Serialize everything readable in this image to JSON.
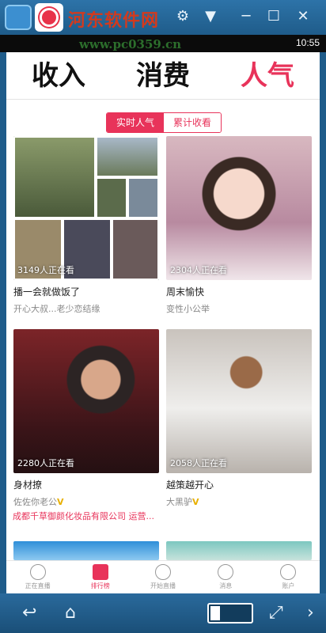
{
  "emulator": {
    "watermark_top": "河东软件网",
    "watermark_url": "www.pc0359.cn",
    "status_time": "10:55",
    "controls": [
      "minimize-icon",
      "restore-icon",
      "close-icon"
    ],
    "bottom_buttons": [
      "back-icon",
      "home-icon",
      "keyboard-icon",
      "fullscreen-icon",
      "next-icon"
    ]
  },
  "header": {
    "tabs": [
      {
        "label": "收入"
      },
      {
        "label": "消费"
      },
      {
        "label": "人气"
      }
    ]
  },
  "segment": {
    "items": [
      {
        "label": "实时人气"
      },
      {
        "label": "累计收看"
      }
    ]
  },
  "cards": [
    {
      "viewers": "3149人正在看",
      "title": "播一会就做饭了",
      "host": "开心大叔...老少恋结缘"
    },
    {
      "viewers": "2304人正在看",
      "title": "周末愉快",
      "host": "变性小公举"
    },
    {
      "viewers": "2280人正在看",
      "title": "身材撩",
      "host": "佐佐你老公",
      "vip": "V"
    },
    {
      "viewers": "2058人正在看",
      "title": "越策越开心",
      "host": "大黑驴",
      "vip": "V"
    }
  ],
  "promo": "成都千草御颜化妆品有限公司 运营...",
  "bottom_nav": [
    {
      "label": "正在直播",
      "icon": "live-icon"
    },
    {
      "label": "排行榜",
      "icon": "ranking-icon"
    },
    {
      "label": "开始直播",
      "icon": "start-live-icon"
    },
    {
      "label": "消息",
      "icon": "message-icon"
    },
    {
      "label": "账户",
      "icon": "account-icon"
    }
  ],
  "colors": {
    "accent": "#e8335a",
    "emulator_frame": "#1f5c8a"
  }
}
